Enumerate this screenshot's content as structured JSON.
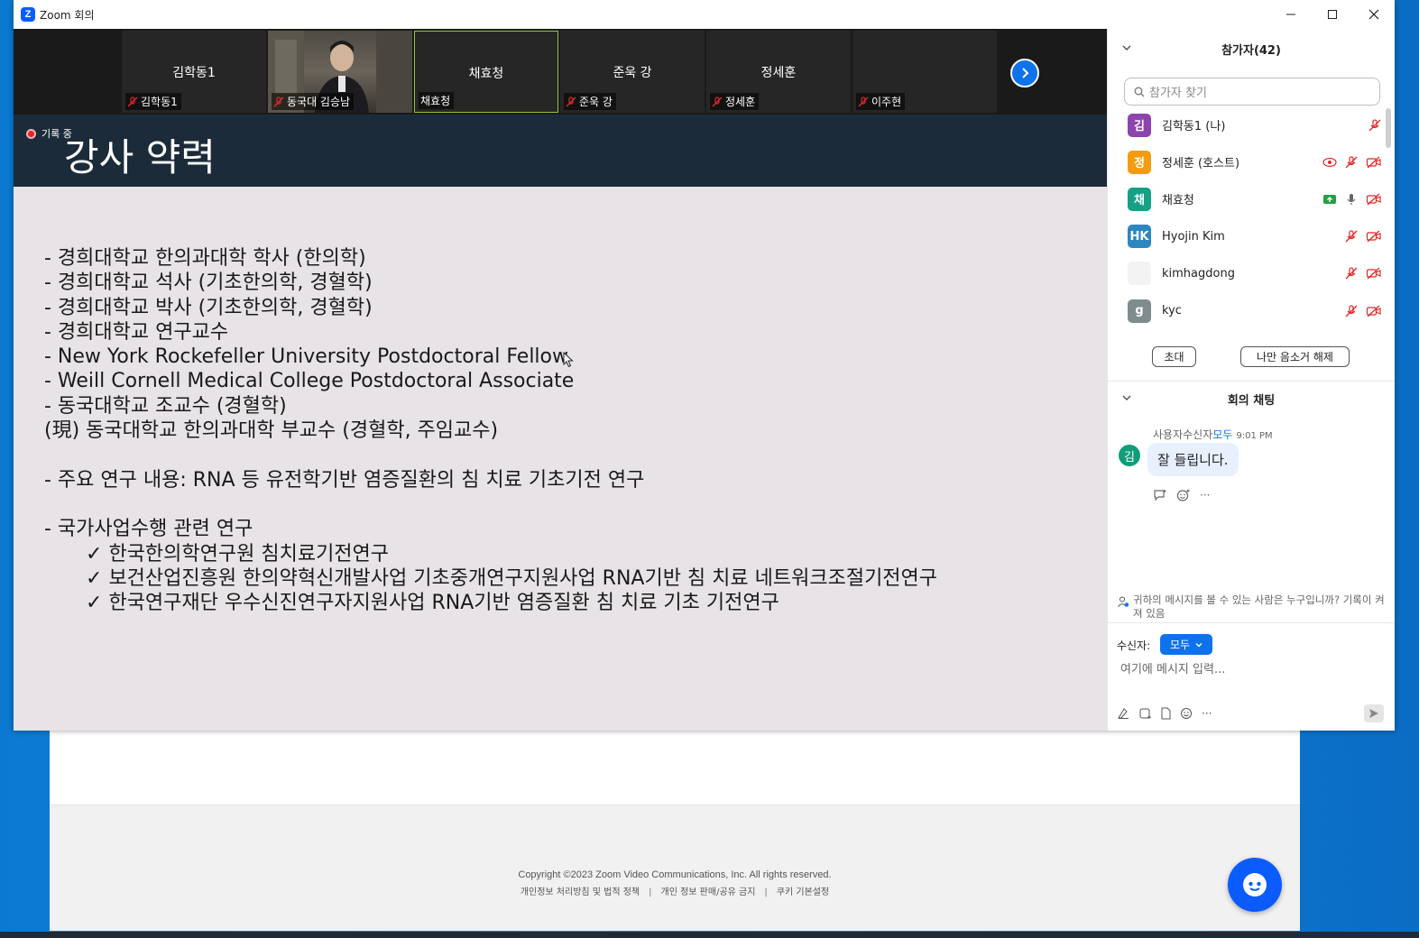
{
  "window": {
    "title": "Zoom 회의",
    "logo_letter": "Z"
  },
  "gallery": {
    "tiles": [
      {
        "name": "김학동1",
        "label": "김학동1",
        "muted": true,
        "video": false,
        "active": false
      },
      {
        "name": "",
        "label": "동국대 김승남",
        "muted": true,
        "video": true,
        "active": false
      },
      {
        "name": "채효청",
        "label": "채효청",
        "muted": false,
        "video": false,
        "active": true
      },
      {
        "name": "준욱 강",
        "label": "준욱 강",
        "muted": true,
        "video": false,
        "active": false
      },
      {
        "name": "정세훈",
        "label": "정세훈",
        "muted": true,
        "video": false,
        "active": false
      },
      {
        "name": "",
        "label": "이주현",
        "muted": true,
        "video": false,
        "active": false
      }
    ]
  },
  "slide": {
    "recording_label": "기록 중",
    "title": "강사 약력",
    "lines": [
      "- 경희대학교 한의과대학 학사 (한의학)",
      "- 경희대학교 석사 (기초한의학, 경혈학)",
      "- 경희대학교 박사 (기초한의학, 경혈학)",
      "- 경희대학교 연구교수",
      "- New York Rockefeller University Postdoctoral Fellow",
      "- Weill Cornell Medical College Postdoctoral Associate",
      "- 동국대학교 조교수 (경혈학)",
      "(現) 동국대학교 한의과대학 부교수 (경혈학, 주임교수)",
      "- 주요 연구 내용: RNA 등 유전학기반 염증질환의 침 치료 기초기전 연구",
      "- 국가사업수행 관련 연구"
    ],
    "checks": [
      "한국한의학연구원 침치료기전연구",
      "보건산업진흥원 한의약혁신개발사업 기초중개연구지원사업 RNA기반 침 치료 네트워크조절기전연구",
      "한국연구재단 우수신진연구자지원사업 RNA기반 염증질환 침 치료 기초 기전연구"
    ]
  },
  "participants": {
    "header": "참가자(42)",
    "search_placeholder": "참가자 찾기",
    "list": [
      {
        "avatar": "김",
        "color": "#8e44ad",
        "name": "김학동1 (나)",
        "icons": [
          "mic-muted"
        ]
      },
      {
        "avatar": "정",
        "color": "#f39c12",
        "name": "정세훈 (호스트)",
        "icons": [
          "recording",
          "mic-muted",
          "video-off"
        ]
      },
      {
        "avatar": "채",
        "color": "#16a085",
        "name": "채효청",
        "icons": [
          "share",
          "mic-on",
          "video-off"
        ]
      },
      {
        "avatar": "HK",
        "color": "#2e86c1",
        "name": "Hyojin Kim",
        "icons": [
          "mic-muted",
          "video-off"
        ]
      },
      {
        "avatar": "",
        "color": "#f3f3f3",
        "name": "kimhagdong",
        "icons": [
          "mic-muted",
          "video-off"
        ]
      },
      {
        "avatar": "g",
        "color": "#7f8c8d",
        "name": "kyc",
        "icons": [
          "mic-muted",
          "video-off"
        ]
      }
    ],
    "invite_label": "초대",
    "unmute_me_label": "나만 음소거 해제"
  },
  "chat": {
    "header": "회의 채팅",
    "message": {
      "sender_avatar": "김",
      "from": "사용자수신자",
      "to": "모두",
      "time": "9:01 PM",
      "text": "잘 들립니다."
    },
    "privacy_note": "귀하의 메시지를 볼 수 있는 사람은 누구입니까? 기록이 켜져 있음",
    "recipient_label": "수신자:",
    "recipient_value": "모두",
    "input_placeholder": "여기에 메시지 입력..."
  },
  "footer": {
    "copyright": "Copyright ©2023 Zoom Video Communications, Inc. All rights reserved.",
    "links": [
      "개인정보 처리방침 및 법적 정책",
      "개인 정보 판매/공유 금지",
      "쿠키 기본설정"
    ]
  },
  "colors": {
    "zoom_blue": "#0e72ed",
    "muted_red": "#e02828",
    "slide_header": "#1c2b3a",
    "slide_bg": "#e8e3e6"
  }
}
